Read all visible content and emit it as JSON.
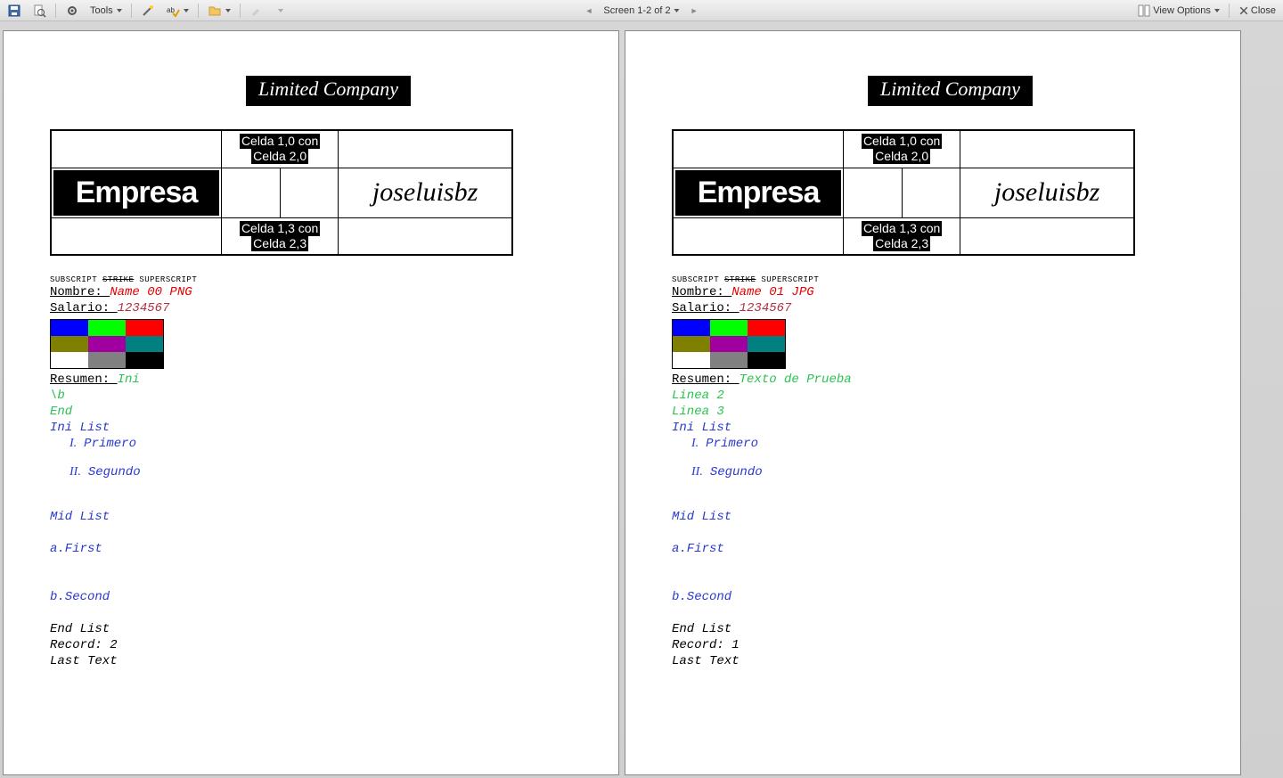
{
  "toolbar": {
    "tools_label": "Tools",
    "screen_label": "Screen 1-2 of 2",
    "view_options_label": "View Options",
    "close_label": "Close"
  },
  "swatch_colors": [
    "#0000ff",
    "#00ff00",
    "#ff0000",
    "#808000",
    "#a000a0",
    "#008080",
    "#ffffff",
    "#808080",
    "#000000"
  ],
  "common": {
    "logo_text": "Limited Company",
    "empresa": "Empresa",
    "celda_10": "Celda 1,0 con",
    "celda_20": "Celda 2,0",
    "celda_13": "Celda 1,3 con",
    "celda_23": "Celda 2,3",
    "jose_text": "joseluisbz",
    "subscript": "SUBSCRIPT",
    "strike": "STRIKE",
    "superscript": "SUPERSCRIPT",
    "nombre_label": "Nombre: ",
    "salario_label": "Salario: ",
    "salario_value": "1234567",
    "resumen_label": "Resumen: ",
    "ini_list": "Ini List",
    "list1_num": "I.",
    "list1_text": "Primero",
    "list2_num": "II.",
    "list2_text": "Segundo",
    "mid_list": "Mid List",
    "a_first": "a.First",
    "b_second": "b.Second",
    "end_list": "End List",
    "record_label": "Record: ",
    "last_text": "Last Text"
  },
  "pages": [
    {
      "nombre_value": "Name 00 PNG",
      "resumen_lines": [
        "Ini"
      ],
      "extra_lines": [
        "\\b",
        "End"
      ],
      "record": "2"
    },
    {
      "nombre_value": "Name 01 JPG",
      "resumen_lines": [
        "Texto de Prueba"
      ],
      "extra_lines": [
        "Linea 2",
        "Linea 3"
      ],
      "record": "1"
    }
  ]
}
